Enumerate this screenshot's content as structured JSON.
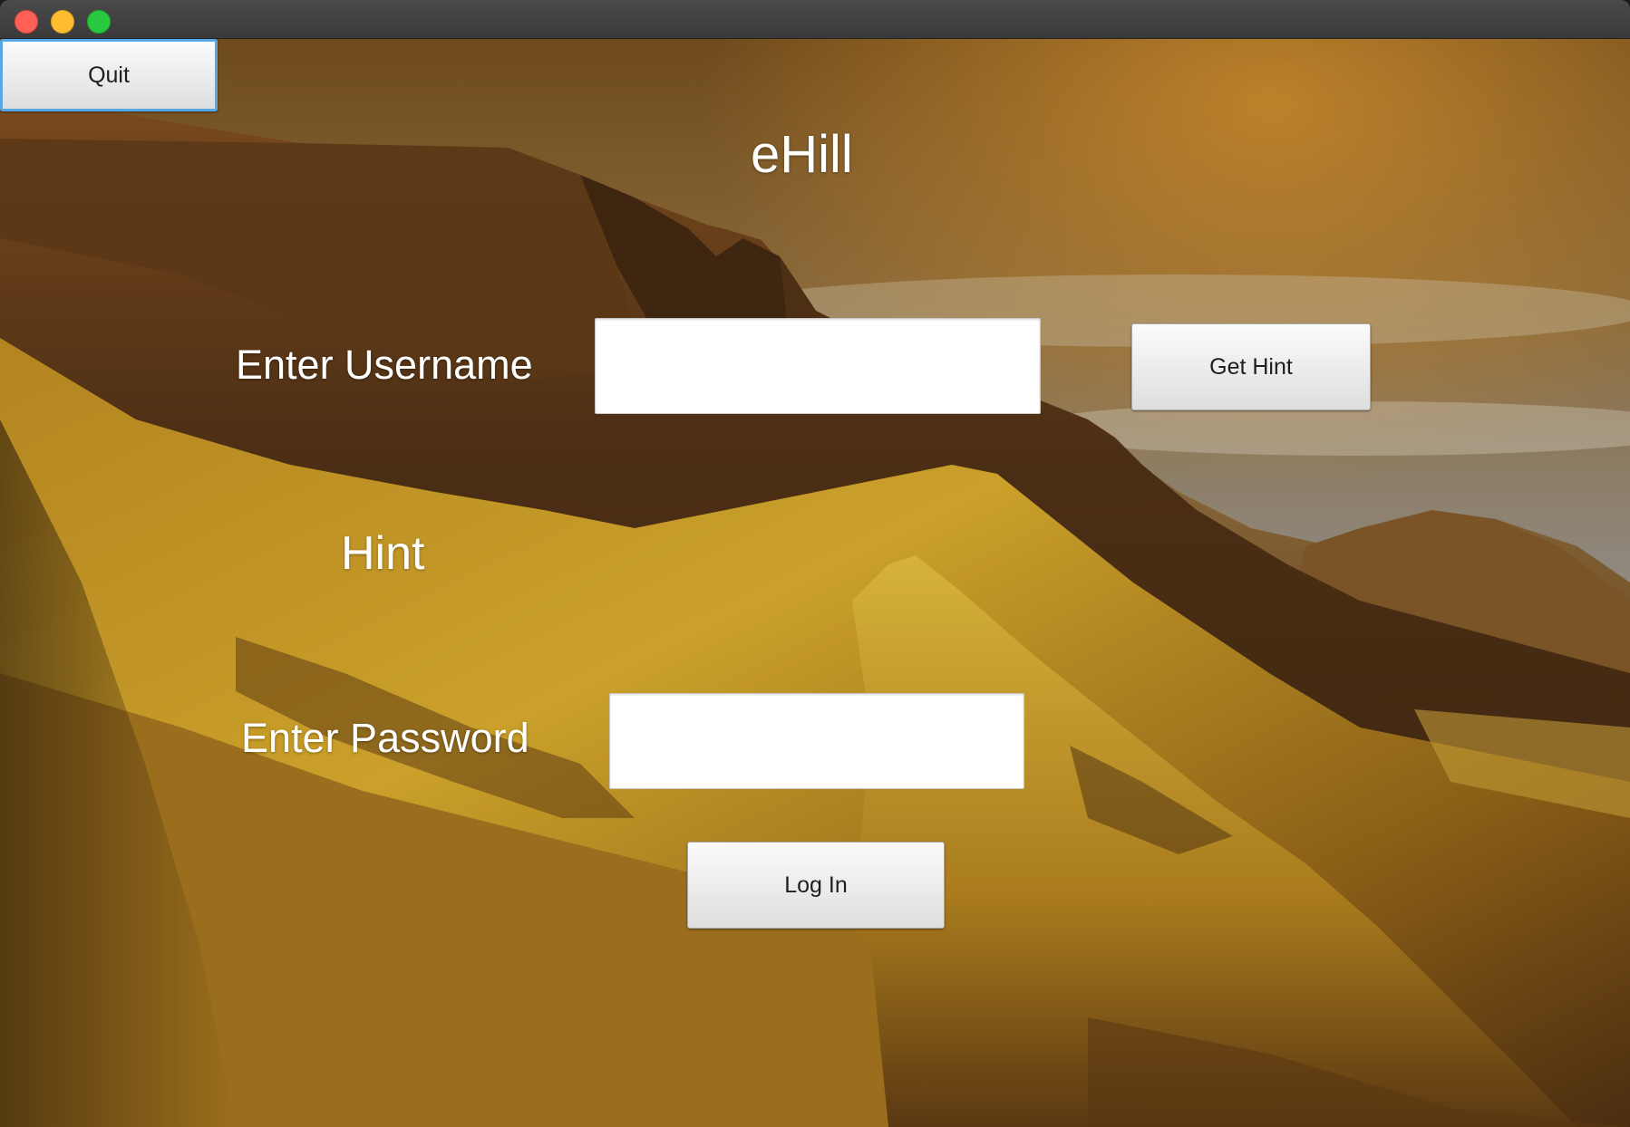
{
  "window": {
    "controls": [
      "close",
      "minimize",
      "zoom"
    ]
  },
  "app": {
    "title": "eHill"
  },
  "toolbar": {
    "quit_label": "Quit"
  },
  "form": {
    "username_label": "Enter Username",
    "username_value": "",
    "hint_button_label": "Get Hint",
    "hint_label": "Hint",
    "password_label": "Enter Password",
    "password_value": "",
    "login_button_label": "Log In"
  },
  "colors": {
    "close": "#fe5f57",
    "minimize": "#febc2e",
    "zoom": "#28c840",
    "focus_ring": "#55a7e6"
  }
}
